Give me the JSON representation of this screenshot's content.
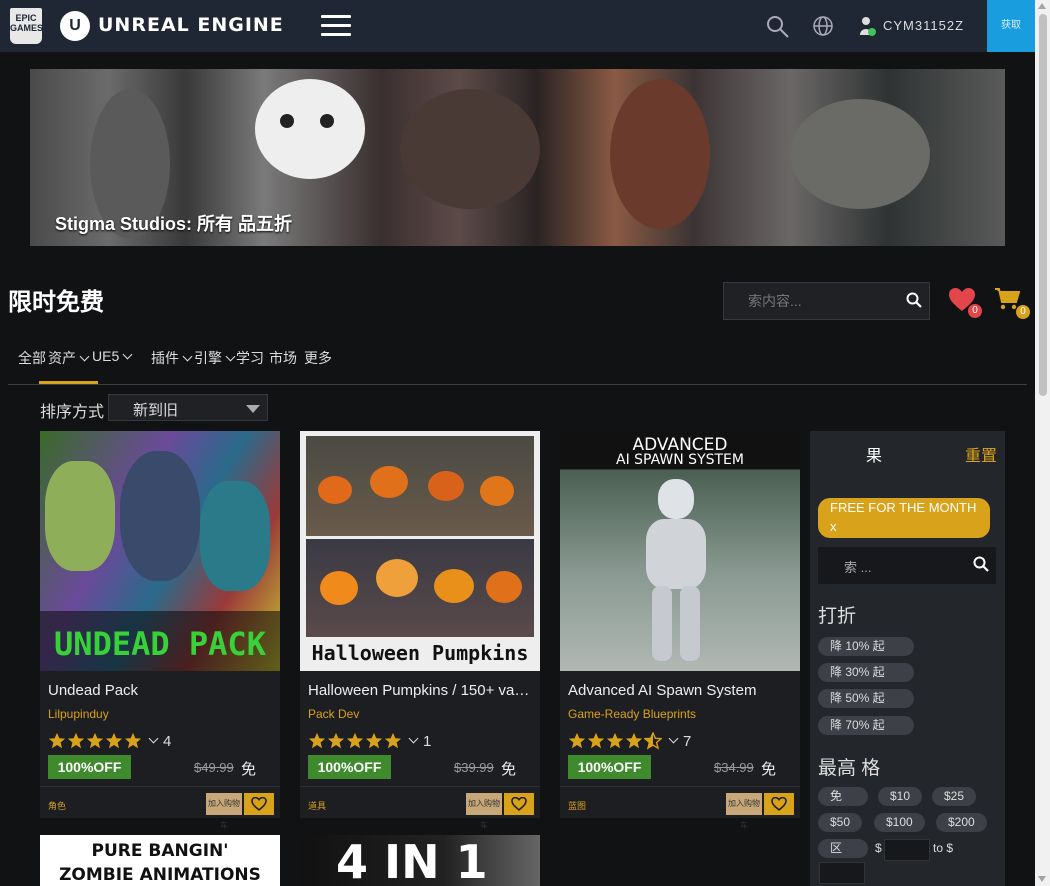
{
  "topbar": {
    "epic_logo_text": "EPIC GAMES",
    "ue_logo_text": "U",
    "title": "UNREAL ENGINE",
    "user_name": "CYM31152Z",
    "get_button": "获取"
  },
  "banner": {
    "caption": "Stigma Studios: 所有 品五折"
  },
  "page": {
    "title": "限时免费",
    "search_placeholder": "索内容...",
    "wishlist_count": "0",
    "cart_count": "0"
  },
  "categories": [
    "全部",
    "资产",
    "UE5",
    "插件",
    "引擎",
    "学习",
    "市场",
    "更多"
  ],
  "sort": {
    "label": "排序方式",
    "selected": "新到旧"
  },
  "products": [
    {
      "name": "Undead Pack",
      "seller": "Lilpupinduy",
      "rating": 5,
      "rating_count": "4",
      "discount": "100%OFF",
      "old_price": "$49.99",
      "new_price": "免",
      "category": "角色",
      "add_button": "加入购物车"
    },
    {
      "name": "Halloween Pumpkins / 150+ variations",
      "seller": "Pack Dev",
      "rating": 5,
      "rating_count": "1",
      "discount": "100%OFF",
      "old_price": "$39.99",
      "new_price": "免",
      "category": "道具",
      "add_button": "加入购物车"
    },
    {
      "name": "Advanced AI Spawn System",
      "seller": "Game-Ready Blueprints",
      "rating": 4.5,
      "rating_count": "7",
      "discount": "100%OFF",
      "old_price": "$34.99",
      "new_price": "免",
      "category": "蓝图",
      "add_button": "加入购物车"
    }
  ],
  "thumbnails": {
    "undead_text": "UNDEAD PACK",
    "pumpkin_text": "Halloween Pumpkins",
    "ai_line1": "ADVANCED",
    "ai_line2": "AI SPAWN SYSTEM",
    "zombie_line1": "PURE BANGIN'",
    "zombie_line2": "ZOMBIE ANIMATIONS",
    "fourinone": "4 IN 1"
  },
  "filters": {
    "header": "果",
    "reset": "重置",
    "active_chip": "FREE FOR THE MONTH x",
    "search_placeholder": "索 ...",
    "discount_title": "打折",
    "discounts": [
      "降 10% 起",
      "降 30% 起",
      "降 50% 起",
      "降 70% 起"
    ],
    "price_title": "最高 格",
    "prices": [
      "免",
      "$10",
      "$25",
      "$50",
      "$100",
      "$200"
    ],
    "range_label": "区",
    "range_from": "$",
    "range_to": "to $"
  },
  "colors": {
    "accent": "#d9a21b",
    "topbar": "#202734",
    "discount_green": "#3e8a2d",
    "get_button": "#1a9dde"
  }
}
